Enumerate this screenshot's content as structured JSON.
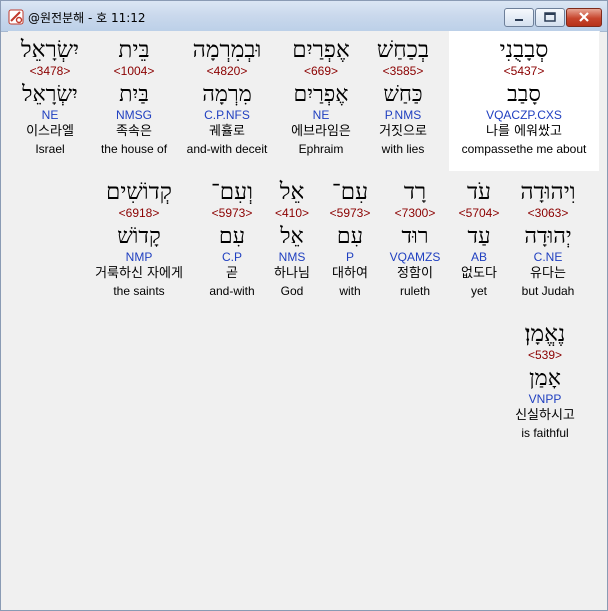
{
  "window": {
    "title": "@원전분해 - 호 11:12"
  },
  "rows": [
    [
      {
        "heb": "סְבָבֻנִי",
        "num": "<5437>",
        "heb2": "סָבַב",
        "morph": "VQACZP.CXS",
        "kor": "나를 에워쌌고",
        "eng": "compassethe me about"
      },
      {
        "heb": "בְכַחַשׁ",
        "num": "<3585>",
        "heb2": "כַּחַשׁ",
        "morph": "P.NMS",
        "kor": "거짓으로",
        "eng": "with lies"
      },
      {
        "heb": "אֶפְרַיִם",
        "num": "<669>",
        "heb2": "אֶפְרַיִם",
        "morph": "NE",
        "kor": "에브라임은",
        "eng": "Ephraim"
      },
      {
        "heb": "וּבְמִרְמָה",
        "num": "<4820>",
        "heb2": "מִרְמָה",
        "morph": "C.P.NFS",
        "kor": "궤휼로",
        "eng": "and-with deceit"
      },
      {
        "heb": "בֵּית",
        "num": "<1004>",
        "heb2": "בַּיִת",
        "morph": "NMSG",
        "kor": "족속은",
        "eng": "the house of"
      },
      {
        "heb": "יִשְׂרָאֵל",
        "num": "<3478>",
        "heb2": "יִשְׂרָאֵל",
        "morph": "NE",
        "kor": "이스라엘",
        "eng": "Israel"
      }
    ],
    [
      {
        "heb": "וִיהוּדָה",
        "num": "<3063>",
        "heb2": "יְהוּדָה",
        "morph": "C.NE",
        "kor": "유다는",
        "eng": "but Judah"
      },
      {
        "heb": "עֹד",
        "num": "<5704>",
        "heb2": "עַד",
        "morph": "AB",
        "kor": "없도다",
        "eng": "yet"
      },
      {
        "heb": "רָד",
        "num": "<7300>",
        "heb2": "רוּד",
        "morph": "VQAMZS",
        "kor": "정함이",
        "eng": "ruleth"
      },
      {
        "heb": "עִם־",
        "num": "<5973>",
        "heb2": "עִם",
        "morph": "P",
        "kor": "대하여",
        "eng": "with"
      },
      {
        "heb": "אֵל",
        "num": "<410>",
        "heb2": "אֵל",
        "morph": "NMS",
        "kor": "하나님",
        "eng": "God"
      },
      {
        "heb": "וְעִם־",
        "num": "<5973>",
        "heb2": "עִם",
        "morph": "C.P",
        "kor": "곧",
        "eng": "and-with"
      },
      {
        "heb": "קְדוֹשִׁים",
        "num": "<6918>",
        "heb2": "קָדוֹשׁ",
        "morph": "NMP",
        "kor": "거룩하신 자에게",
        "eng": "the saints"
      }
    ],
    [
      {
        "heb": "נֶאֱמָן׃",
        "num": "<539>",
        "heb2": "אָמַן",
        "morph": "VNPP",
        "kor": "신실하시고",
        "eng": "is faithful"
      }
    ]
  ]
}
